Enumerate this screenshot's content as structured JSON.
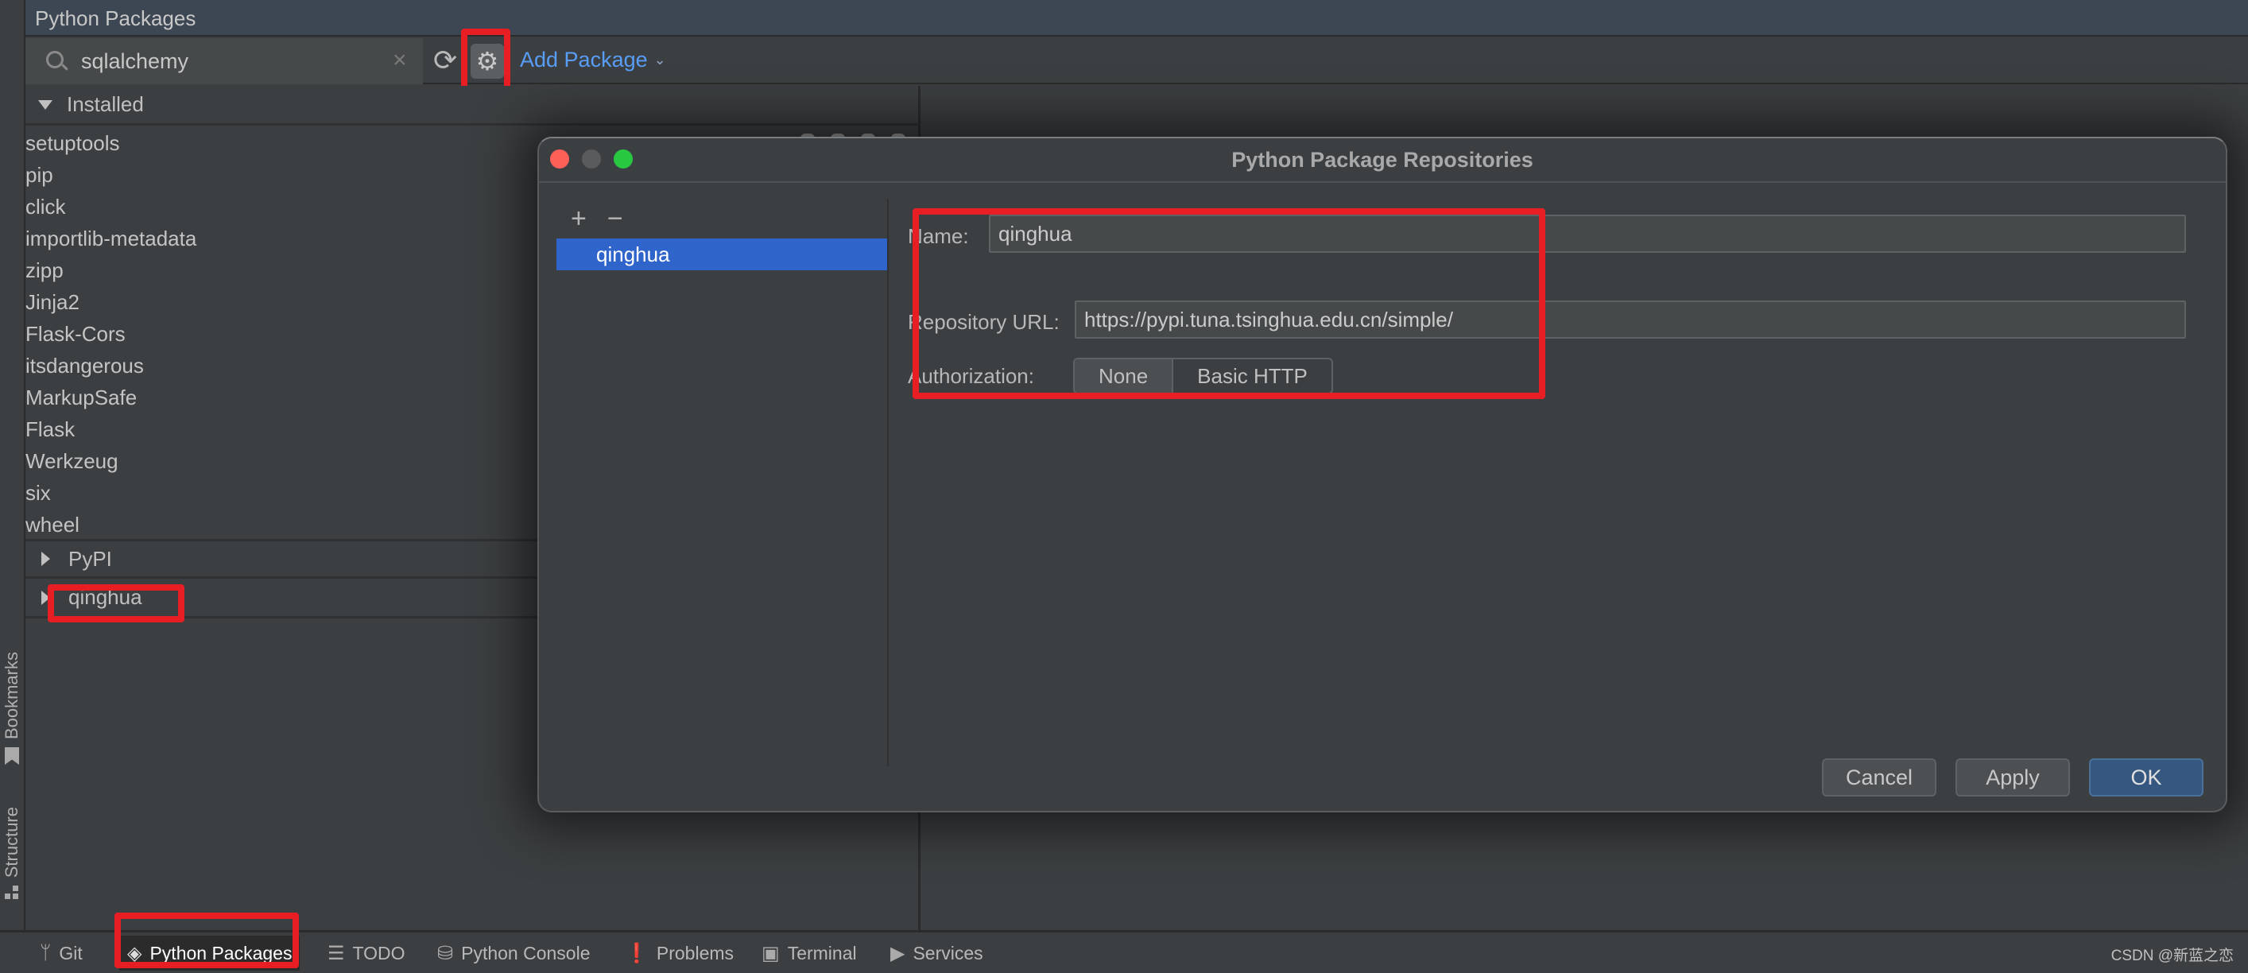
{
  "tool_window": {
    "title": "Python Packages"
  },
  "toolbar": {
    "search_value": "sqlalchemy",
    "clear_glyph": "×",
    "refresh_glyph": "⟳",
    "gear_glyph": "⚙",
    "add_package_label": "Add Package",
    "add_package_chevron": "⌄"
  },
  "packages": {
    "installed_label": "Installed",
    "installed": [
      "setuptools",
      "pip",
      "click",
      "importlib-metadata",
      "zipp",
      "Jinja2",
      "Flask-Cors",
      "itsdangerous",
      "MarkupSafe",
      "Flask",
      "Werkzeug",
      "six",
      "wheel"
    ],
    "repositories": [
      {
        "label": "PyPI"
      },
      {
        "label": "qinghua"
      }
    ]
  },
  "left_strip": {
    "bookmarks_label": "Bookmarks",
    "structure_label": "Structure"
  },
  "dialog": {
    "title": "Python Package Repositories",
    "add_glyph": "+",
    "remove_glyph": "−",
    "repositories": [
      "qinghua"
    ],
    "name_label": "Name:",
    "name_value": "qinghua",
    "url_label": "Repository URL:",
    "url_value": "https://pypi.tuna.tsinghua.edu.cn/simple/",
    "auth_label": "Authorization:",
    "auth_options": [
      "None",
      "Basic HTTP"
    ],
    "auth_selected": "None",
    "buttons": {
      "cancel": "Cancel",
      "apply": "Apply",
      "ok": "OK"
    }
  },
  "bottom_bar": {
    "tabs": [
      {
        "label": "Git",
        "icon": "git-branch-icon",
        "glyph": "ᛘ"
      },
      {
        "label": "Python Packages",
        "icon": "layers-icon",
        "glyph": "◈",
        "active": true
      },
      {
        "label": "TODO",
        "icon": "list-icon",
        "glyph": "☰"
      },
      {
        "label": "Python Console",
        "icon": "python-icon",
        "glyph": "⛁"
      },
      {
        "label": "Problems",
        "icon": "warning-icon",
        "glyph": "❗"
      },
      {
        "label": "Terminal",
        "icon": "terminal-icon",
        "glyph": "▣"
      },
      {
        "label": "Services",
        "icon": "services-icon",
        "glyph": "▶"
      }
    ],
    "watermark": "CSDN @新蓝之恋"
  },
  "colors": {
    "accent_link": "#589df6",
    "selection": "#2f65ca",
    "ok_button": "#365880",
    "annotation": "#e81e25"
  }
}
